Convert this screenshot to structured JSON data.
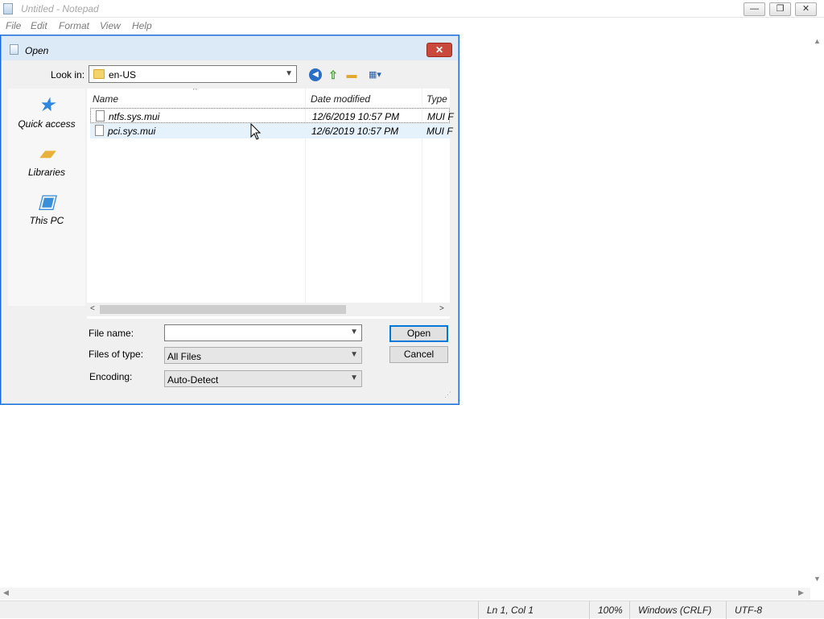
{
  "notepad": {
    "title": "Untitled - Notepad",
    "menu": [
      "File",
      "Edit",
      "Format",
      "View",
      "Help"
    ],
    "window_buttons": {
      "minimize": "—",
      "maximize": "❐",
      "close": "✕"
    },
    "status": {
      "position": "Ln 1, Col 1",
      "zoom": "100%",
      "line_ending": "Windows (CRLF)",
      "encoding": "UTF-8"
    }
  },
  "dialog": {
    "title": "Open",
    "close_glyph": "✕",
    "look_in_label": "Look in:",
    "look_in_value": "en-US",
    "places": [
      {
        "label": "Quick access",
        "icon": "star-icon"
      },
      {
        "label": "Libraries",
        "icon": "libraries-icon"
      },
      {
        "label": "This PC",
        "icon": "computer-icon"
      }
    ],
    "columns": [
      "Name",
      "Date modified",
      "Type"
    ],
    "files": [
      {
        "name": "ntfs.sys.mui",
        "date": "12/6/2019 10:57 PM",
        "type": "MUI F"
      },
      {
        "name": "pci.sys.mui",
        "date": "12/6/2019 10:57 PM",
        "type": "MUI F"
      }
    ],
    "file_name_label": "File name:",
    "file_name_value": "",
    "files_of_type_label": "Files of type:",
    "files_of_type_value": "All Files",
    "encoding_label": "Encoding:",
    "encoding_value": "Auto-Detect",
    "open_button": "Open",
    "cancel_button": "Cancel"
  }
}
